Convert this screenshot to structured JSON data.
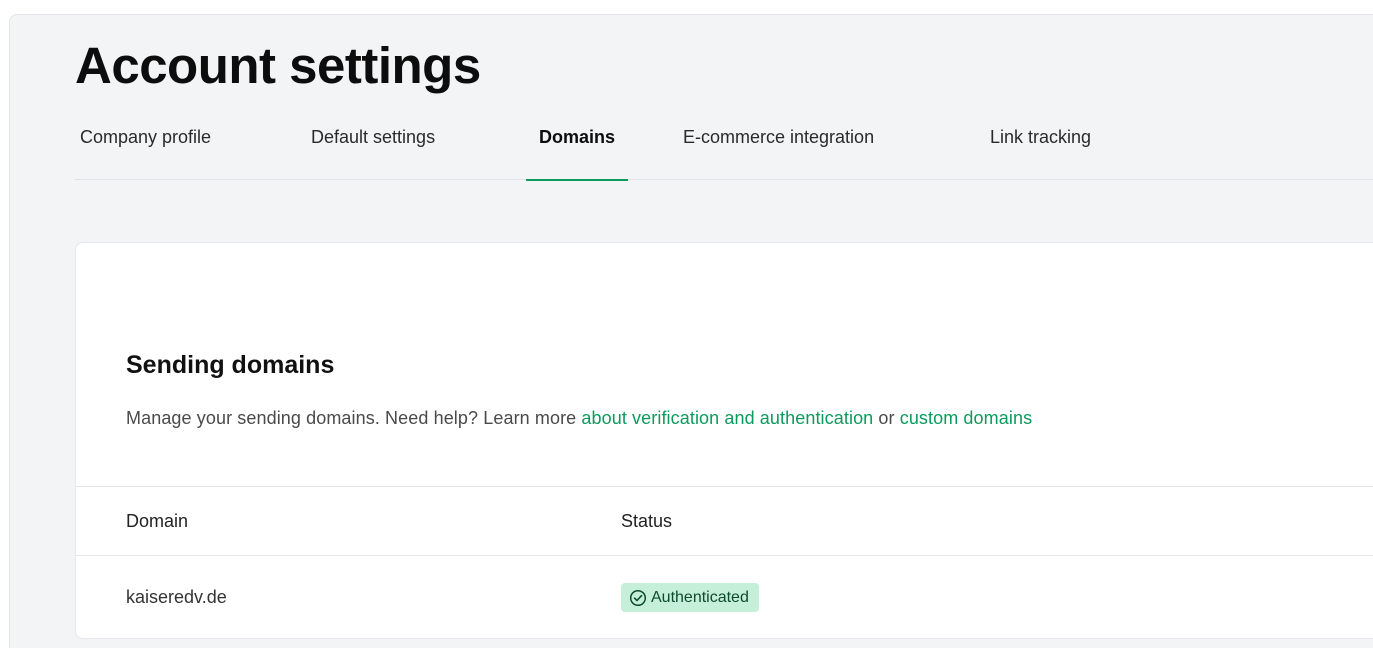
{
  "page": {
    "title": "Account settings"
  },
  "tabs": [
    {
      "label": "Company profile",
      "active": false
    },
    {
      "label": "Default settings",
      "active": false
    },
    {
      "label": "Domains",
      "active": true
    },
    {
      "label": "E-commerce integration",
      "active": false
    },
    {
      "label": "Link tracking",
      "active": false
    }
  ],
  "sending_domains": {
    "title": "Sending domains",
    "description_prefix": "Manage your sending domains. Need help? Learn more ",
    "link_verification": "about verification and authentication",
    "description_or": " or ",
    "link_custom": "custom domains",
    "table": {
      "headers": [
        "Domain",
        "Status"
      ],
      "rows": [
        {
          "domain": "kaiseredv.de",
          "status": "Authenticated",
          "status_icon": "check-circle-icon"
        }
      ]
    }
  },
  "colors": {
    "accent": "#0d9a5d",
    "background": "#f3f4f6",
    "badge_bg": "#c5efd8",
    "badge_text": "#0e4a2e"
  }
}
